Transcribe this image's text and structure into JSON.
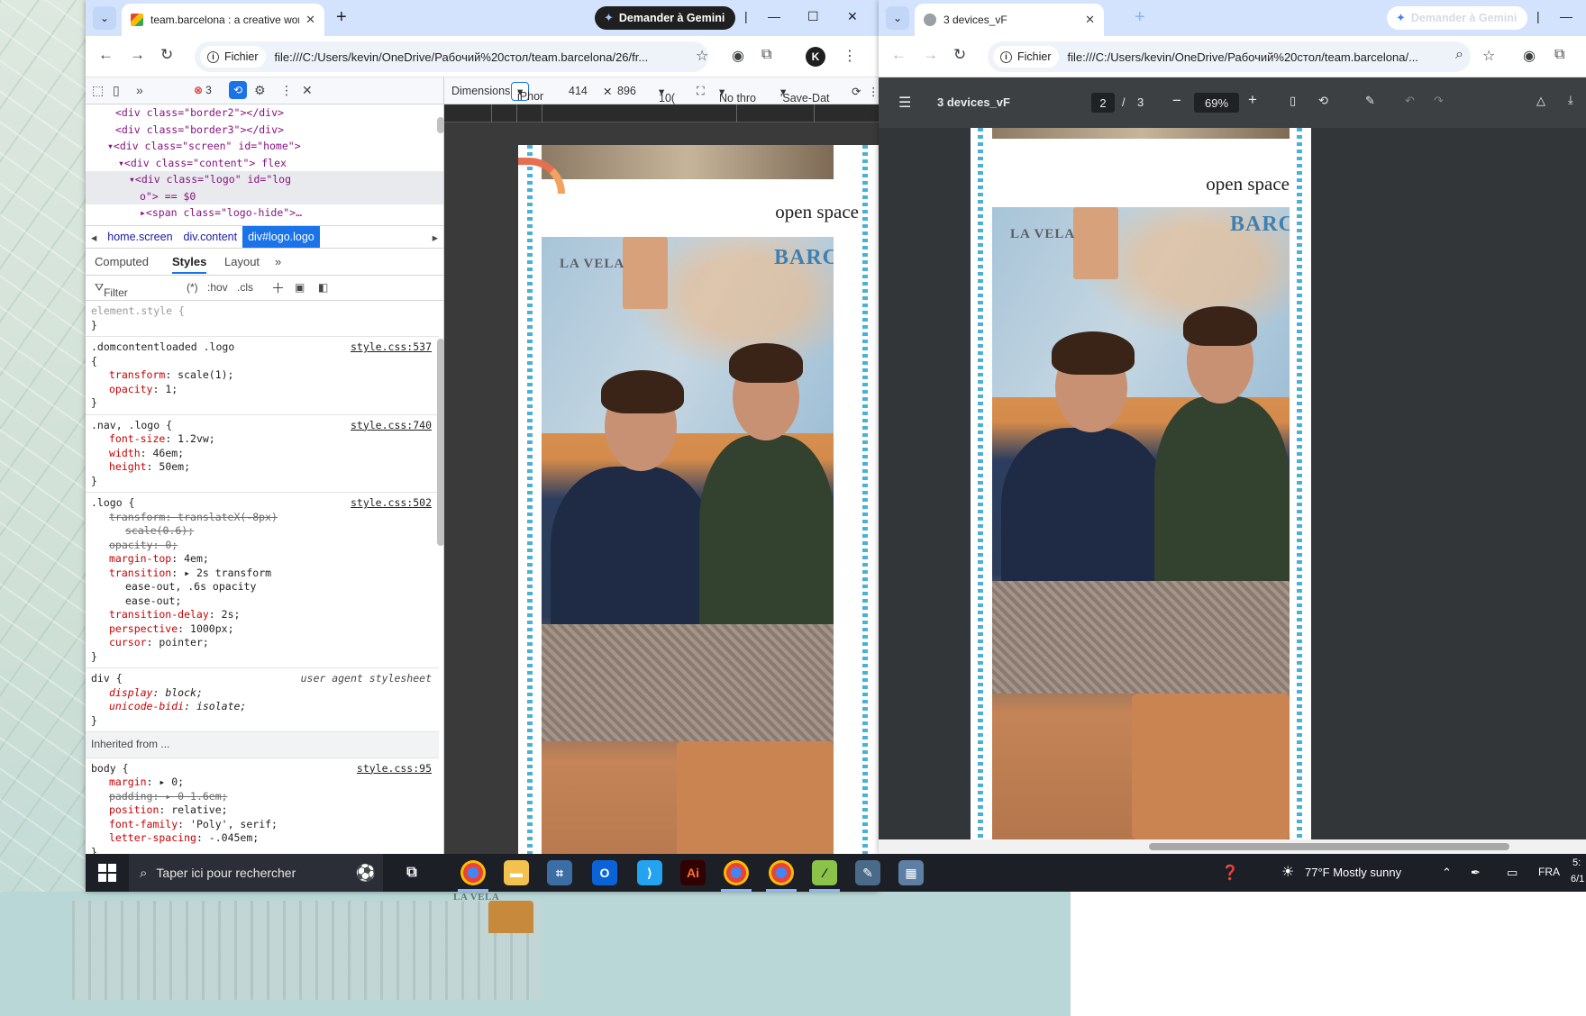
{
  "left_window": {
    "tab_title": "team.barcelona : a creative wor",
    "gemini_label": "Demander à Gemini",
    "address_chip": "Fichier",
    "url": "file:///C:/Users/kevin/OneDrive/Рабочий%20стол/team.barcelona/26/fr...",
    "devtools": {
      "error_count": "3",
      "dom_lines": [
        {
          "indent": 2,
          "text": "<div class=\"border2\"></div>"
        },
        {
          "indent": 2,
          "text": "<div class=\"border3\"></div>"
        },
        {
          "indent": 2,
          "text": "▾<div class=\"screen\" id=\"home\">"
        },
        {
          "indent": 3,
          "text": "▾<div class=\"content\"> flex"
        },
        {
          "indent": 4,
          "text": "▾<div class=\"logo\" id=\"log"
        },
        {
          "indent": 5,
          "text": "o\"> == $0"
        },
        {
          "indent": 5,
          "text": "▸<span class=\"logo-hide\">…"
        }
      ],
      "breadcrumbs": [
        "home.screen",
        "div.content",
        "div#logo.logo"
      ],
      "tabs": [
        "Computed",
        "Styles",
        "Layout"
      ],
      "filter_placeholder": "Filter",
      "filter_tools": [
        ":hov",
        ".cls"
      ],
      "element_style": "element.style {",
      "rules": [
        {
          "selector": ".domcontentloaded .logo",
          "source": "style.css:537",
          "props": [
            [
              "transform",
              "scale(1);",
              false
            ],
            [
              "opacity",
              "1;",
              false
            ]
          ]
        },
        {
          "selector": ".nav, .logo {",
          "source": "style.css:740",
          "props": [
            [
              "font-size",
              "1.2vw;",
              false
            ],
            [
              "width",
              "46em;",
              false
            ],
            [
              "height",
              "50em;",
              false
            ]
          ]
        },
        {
          "selector": ".logo {",
          "source": "style.css:502",
          "props": [
            [
              "transform",
              "translateX(-8px)",
              true
            ],
            [
              "",
              "scale(0.6);",
              true
            ],
            [
              "opacity",
              "0;",
              true
            ],
            [
              "margin-top",
              "4em;",
              false
            ],
            [
              "transition",
              "▸ 2s transform",
              false
            ],
            [
              "",
              "ease-out, .6s opacity",
              false
            ],
            [
              "",
              "ease-out;",
              false
            ],
            [
              "transition-delay",
              "2s;",
              false
            ],
            [
              "perspective",
              "1000px;",
              false
            ],
            [
              "cursor",
              "pointer;",
              false
            ]
          ]
        },
        {
          "selector": "div {",
          "source": "user agent stylesheet",
          "props": [
            [
              "display",
              "block;",
              false
            ],
            [
              "unicode-bidi",
              "isolate;",
              false
            ]
          ]
        }
      ],
      "inherited_label": "Inherited from ...",
      "body_rule": {
        "selector": "body {",
        "source": "style.css:95",
        "props": [
          [
            "margin",
            "▸ 0;",
            false
          ],
          [
            "padding",
            "▸ 0 1.6em;",
            true
          ],
          [
            "position",
            "relative;",
            false
          ],
          [
            "font-family",
            "'Poly', serif;",
            false
          ],
          [
            "letter-spacing",
            "-.045em;",
            false
          ]
        ]
      }
    },
    "emulation": {
      "dimensions_label": "Dimensions:",
      "device": "iPhor",
      "width": "414",
      "height": "896",
      "zoom": "10(",
      "throttle": "No thro",
      "save_data": "'Save-Dat"
    },
    "page": {
      "heading": "open space",
      "photo_labels": [
        "LA VELA",
        "BARC"
      ]
    }
  },
  "right_window": {
    "tab_title": "3 devices_vF",
    "gemini_label": "Demander à Gemini",
    "address_chip": "Fichier",
    "url": "file:///C:/Users/kevin/OneDrive/Рабочий%20стол/team.barcelona/...",
    "pdf": {
      "title": "3 devices_vF",
      "page_current": "2",
      "page_total": "3",
      "zoom": "69%",
      "heading": "open space",
      "photo_labels": [
        "LA VELA",
        "BARC"
      ]
    }
  },
  "taskbar": {
    "search_placeholder": "Taper ici pour rechercher",
    "weather": "77°F  Mostly sunny",
    "language": "FRA",
    "clock_time": "5:",
    "clock_date": "6/1"
  },
  "wallpaper_label": "LA VELA",
  "colors": {
    "accent": "#1a73e8",
    "tab_strip": "#d3e3fd",
    "wave": "#4bb0d8"
  }
}
